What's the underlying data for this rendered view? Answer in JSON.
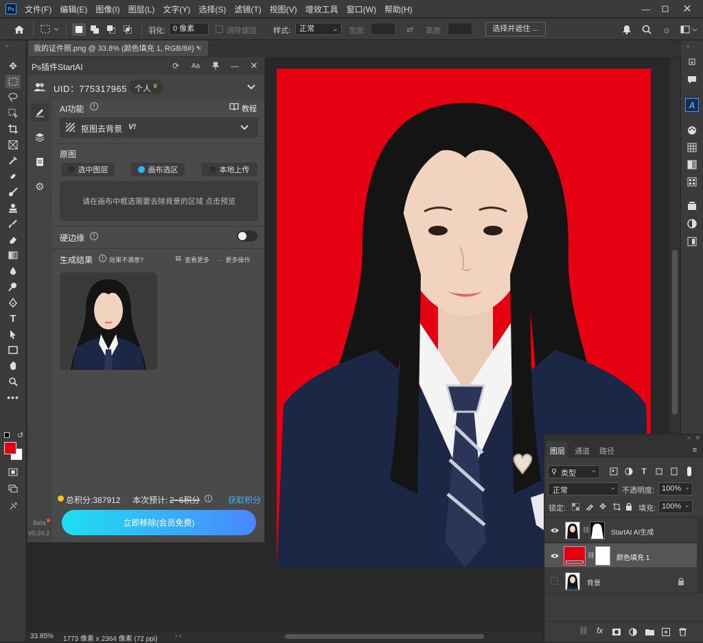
{
  "menubar": {
    "logo": "Ps",
    "items": [
      "文件(F)",
      "编辑(E)",
      "图像(I)",
      "图层(L)",
      "文字(Y)",
      "选择(S)",
      "滤镜(T)",
      "视图(V)",
      "增效工具",
      "窗口(W)",
      "帮助(H)"
    ]
  },
  "options": {
    "feather_label": "羽化:",
    "feather_value": "0 像素",
    "antialias_label": "消除锯齿",
    "style_label": "样式:",
    "style_value": "正常",
    "width_label": "宽度:",
    "height_label": "高度:",
    "select_mask_btn": "选择并遮住 ..."
  },
  "doc_tab": {
    "title": "我的证件照.png @ 33.8% (颜色填充 1, RGB/8#) *",
    "close": "×"
  },
  "plugin": {
    "title": "Ps插件StartAI",
    "uid": "UID：775317965",
    "account_type": "个人",
    "ai_section": "AI功能",
    "tutorial": "教程",
    "feature_name": "抠图去背景",
    "feature_badge": "V!",
    "source_label": "原图",
    "sources": [
      "选中图层",
      "画布选区",
      "本地上传"
    ],
    "hint": "请在画布中框选需要去除背景的区域 点击预览",
    "hard_edge_label": "硬边缘",
    "result_label": "生成结果",
    "unsatisfied": "效果不满意?",
    "view_more": "查看更多",
    "more_ops": "··· 更多操作",
    "points": "总积分:387912",
    "estimate_label": "本次预计:",
    "estimate_value": "2~6积分",
    "get_points": "获取积分",
    "action_btn": "立即移除(会员免费)",
    "beta": "Beta",
    "version": "V0.24.2"
  },
  "layers": {
    "tabs": [
      "图层",
      "通道",
      "路径"
    ],
    "filter_type": "类型",
    "blend_mode": "正常",
    "opacity_label": "不透明度:",
    "opacity": "100%",
    "lock_label": "锁定:",
    "fill_label": "填充:",
    "fill": "100%",
    "rows": [
      {
        "name": "StartAI AI生成",
        "visible": true
      },
      {
        "name": "颜色填充 1",
        "visible": true
      },
      {
        "name": "背景",
        "visible": false
      }
    ]
  },
  "status": {
    "zoom": "33.85%",
    "doc_info": "1773 像素 x 2364 像素 (72 ppi)"
  },
  "colors": {
    "foreground": "#e50012",
    "background": "#ffffff",
    "accent": "#31a8ff",
    "canvas_bg": "#e50012"
  }
}
